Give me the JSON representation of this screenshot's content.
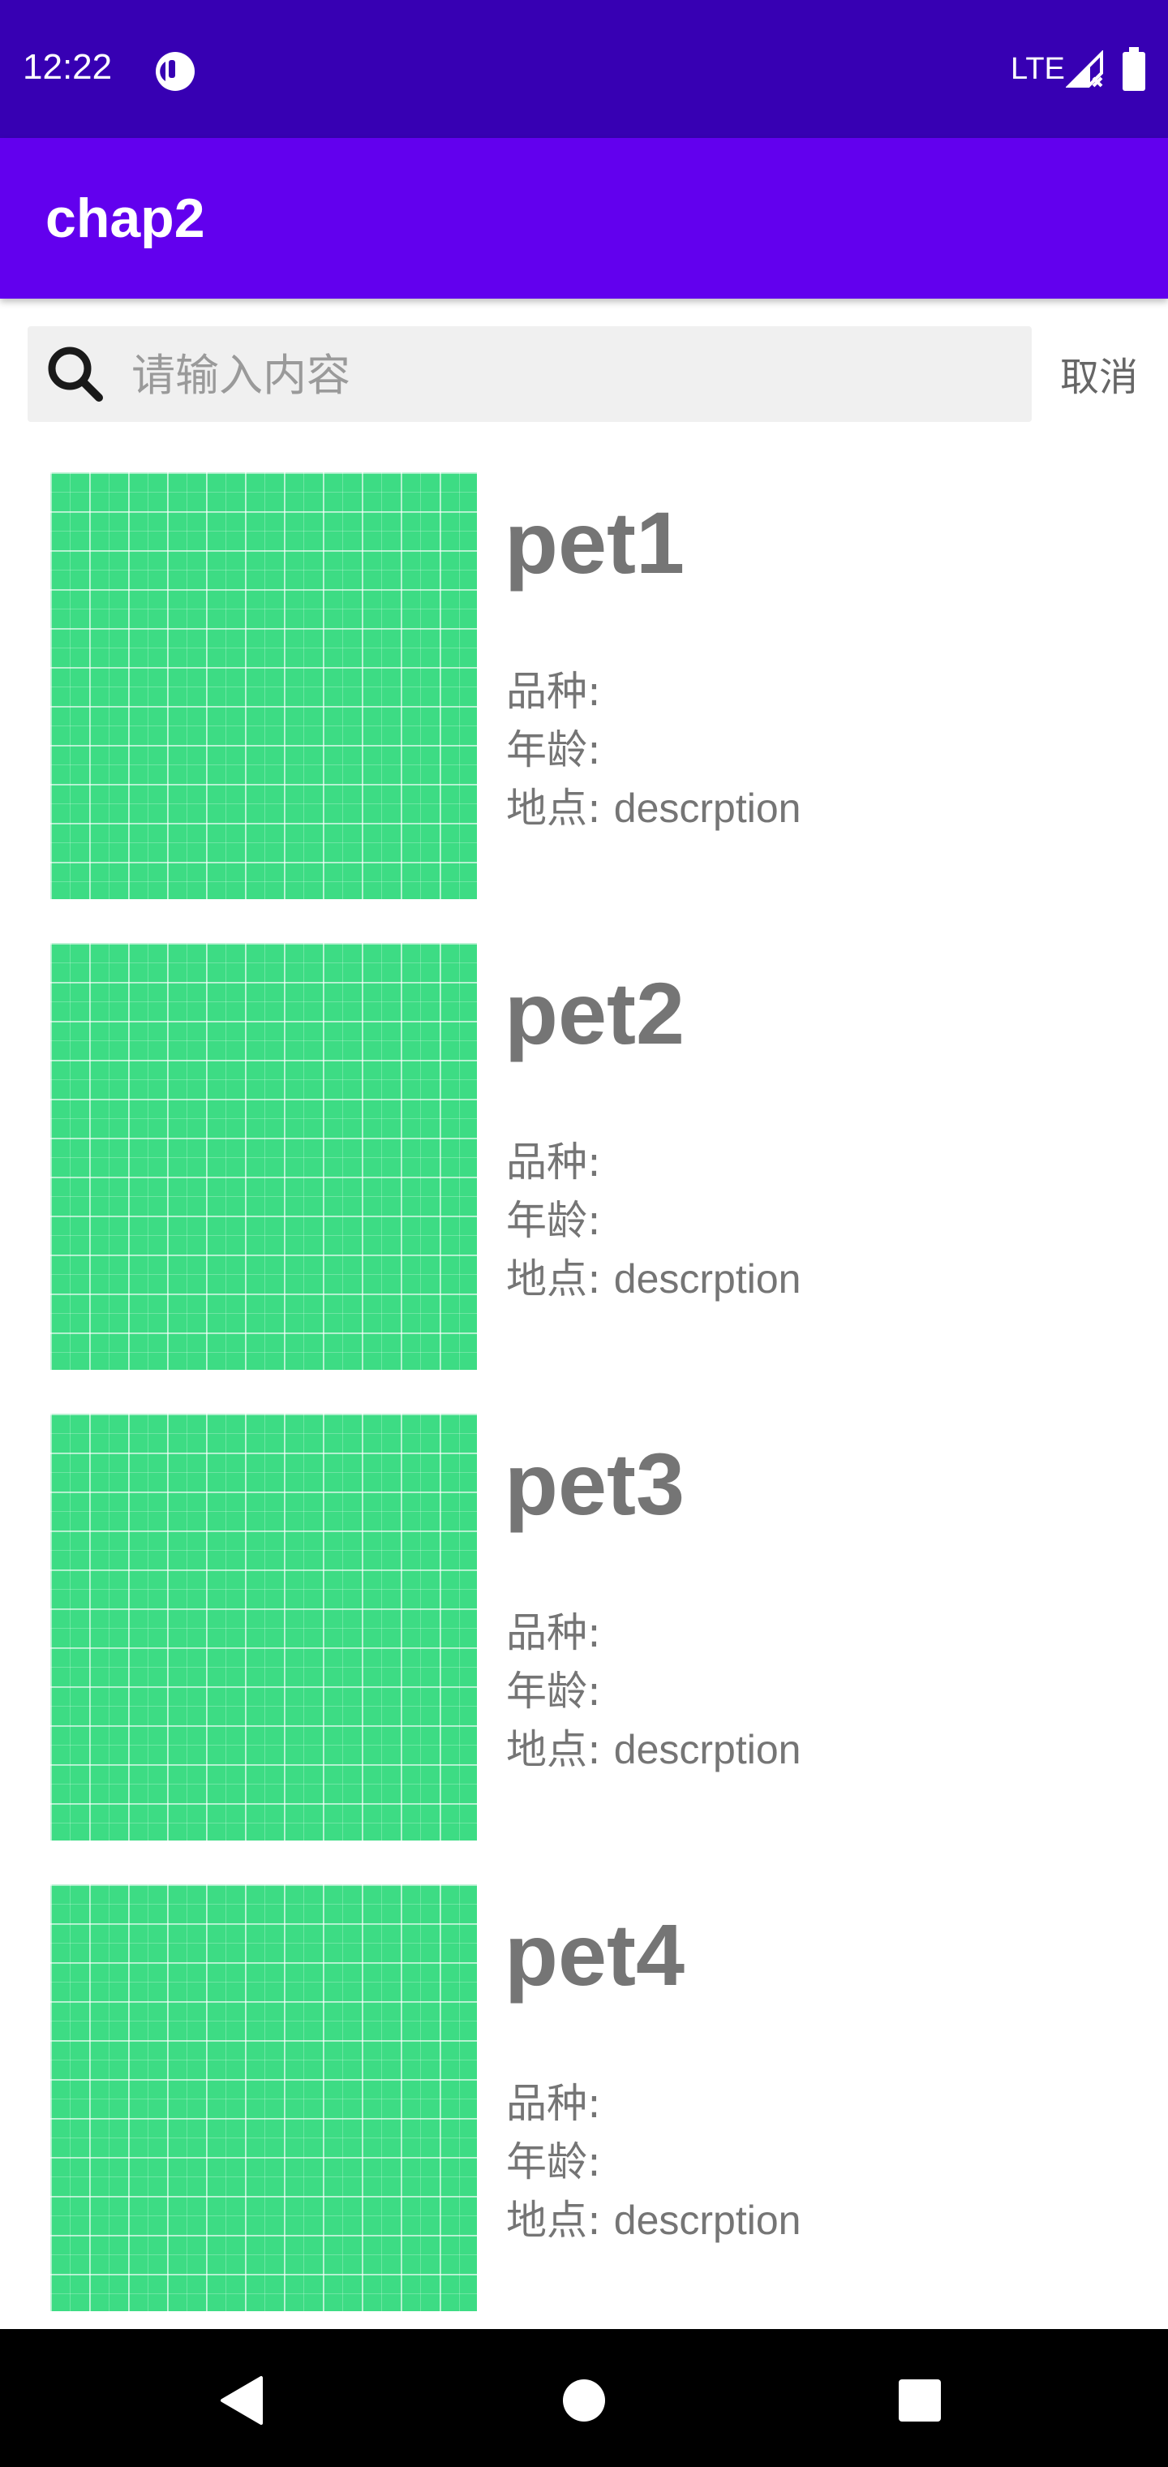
{
  "status_bar": {
    "time": "12:22",
    "network": "LTE",
    "icons": [
      "app-notification-icon",
      "signal-icon",
      "battery-icon"
    ]
  },
  "app_bar": {
    "title": "chap2",
    "color": "#6200ee"
  },
  "search": {
    "placeholder": "请输入内容",
    "value": "",
    "cancel_label": "取消"
  },
  "pets": [
    {
      "name": "pet1",
      "breed_label": "品种:",
      "breed": "",
      "age_label": "年龄:",
      "age": "",
      "location_label": "地点:",
      "location": "descrption"
    },
    {
      "name": "pet2",
      "breed_label": "品种:",
      "breed": "",
      "age_label": "年龄:",
      "age": "",
      "location_label": "地点:",
      "location": "descrption"
    },
    {
      "name": "pet3",
      "breed_label": "品种:",
      "breed": "",
      "age_label": "年龄:",
      "age": "",
      "location_label": "地点:",
      "location": "descrption"
    },
    {
      "name": "pet4",
      "breed_label": "品种:",
      "breed": "",
      "age_label": "年龄:",
      "age": "",
      "location_label": "地点:",
      "location": "descrption"
    }
  ],
  "colors": {
    "status_bar": "#3700b3",
    "app_bar": "#6200ee",
    "image_placeholder": "#3ddc84",
    "text_secondary": "#757575"
  },
  "nav_bar": {
    "icons": [
      "back-icon",
      "home-icon",
      "recents-icon"
    ]
  }
}
